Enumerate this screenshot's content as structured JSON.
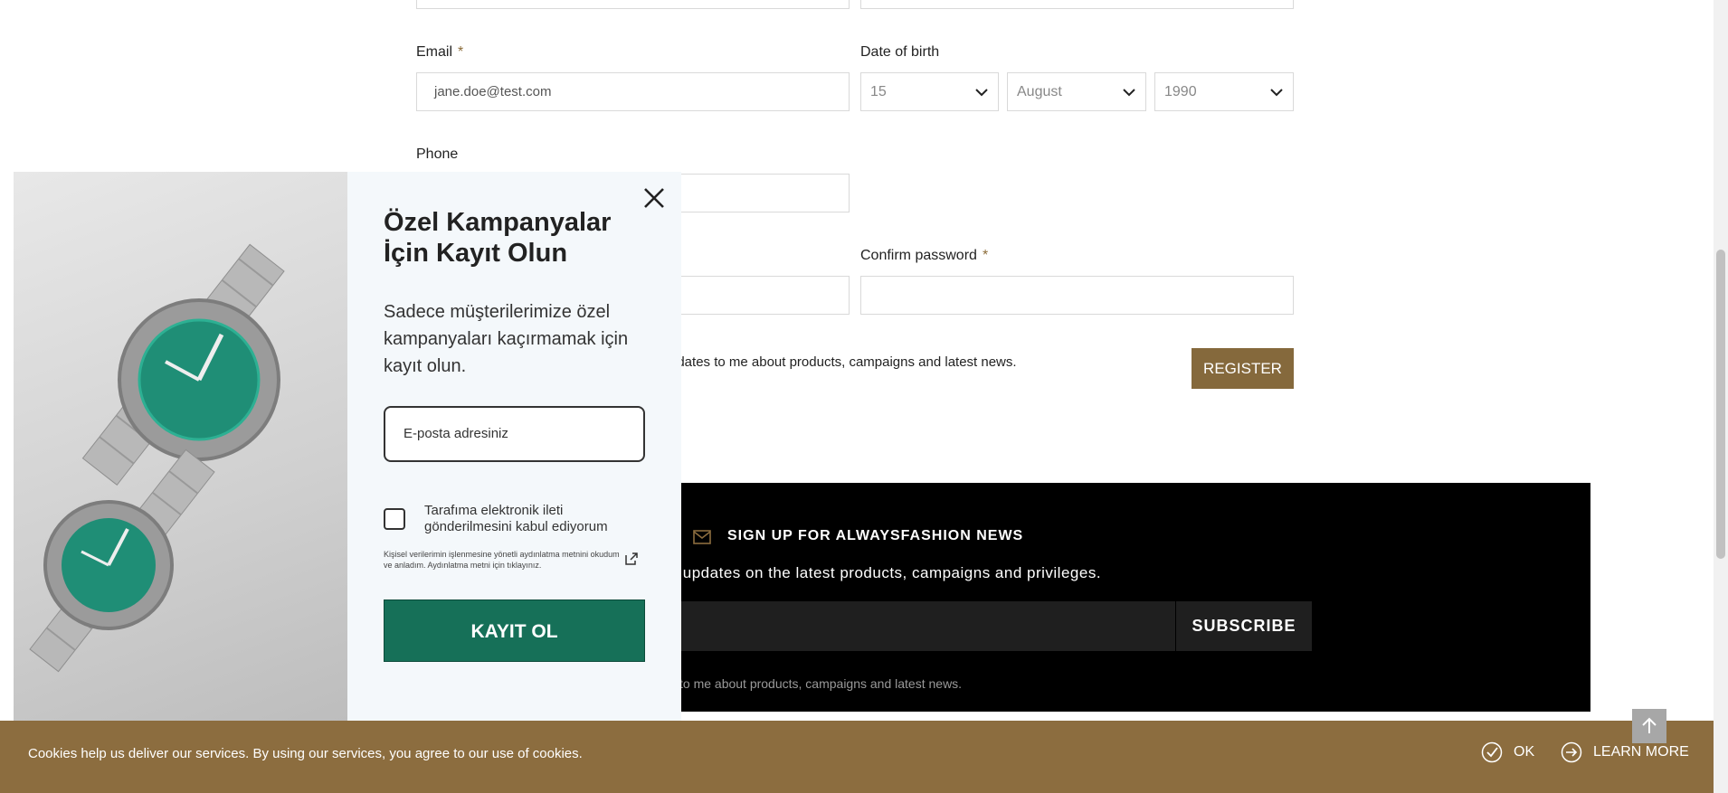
{
  "form": {
    "email_label": "Email",
    "email_required": "*",
    "email_value": "jane.doe@test.com",
    "dob_label": "Date of birth",
    "dob_day": "15",
    "dob_month": "August",
    "dob_year": "1990",
    "phone_label": "Phone",
    "confirm_password_label": "Confirm password",
    "confirm_password_required": "*",
    "consent_text": "pdates to me about products, campaigns and latest news.",
    "register_label": "REGISTER"
  },
  "newsletter": {
    "title": "SIGN UP FOR ALWAYSFASHION NEWS",
    "subtitle": "il updates on the latest products, campaigns and privileges.",
    "subscribe_label": "SUBSCRIBE",
    "consent_text": "to me about products, campaigns and latest news."
  },
  "popup": {
    "title": "Özel Kampanyalar İçin Kayıt Olun",
    "description": "Sadece müşterilerimize özel kampanyaları kaçırmamak için kayıt olun.",
    "email_placeholder": "E-posta adresiniz",
    "checkbox_label": "Tarafıma elektronik ileti gönderilmesini kabul ediyorum",
    "privacy_text": "Kişisel verilerimin işlenmesine yönetli aydınlatma metnini okudum ve anladım. Aydınlatma metni için tıklayınız.",
    "submit_label": "KAYIT OL"
  },
  "cookie": {
    "text": "Cookies help us deliver our services. By using our services, you agree to our use of cookies.",
    "ok_label": "OK",
    "learn_more_label": "LEARN MORE"
  },
  "colors": {
    "accent_gold": "#8c6d3f",
    "popup_green": "#167058",
    "register_button": "#85693c"
  }
}
